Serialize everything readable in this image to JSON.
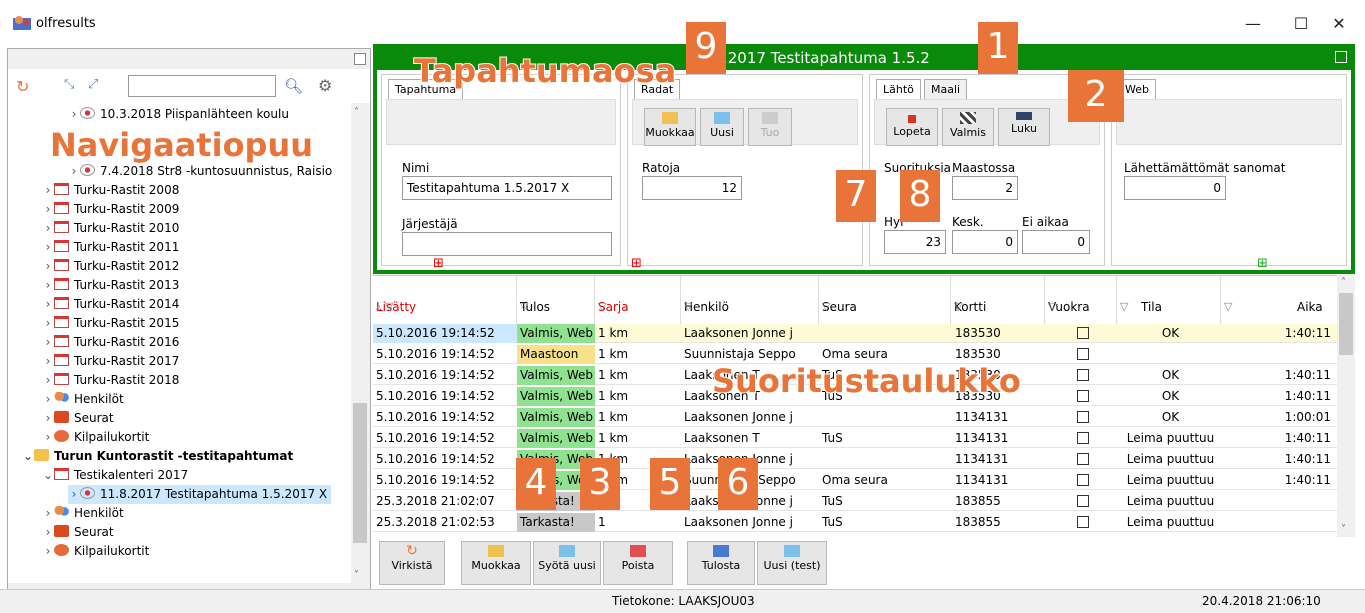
{
  "window": {
    "title": "olfresults",
    "minimize": "—",
    "maximize": "☐",
    "close": "✕"
  },
  "tree": {
    "search_placeholder": "",
    "items": [
      {
        "label": "10.3.2018  Piispanlähteen koulu"
      },
      {
        "label": "7.4.2018  Str8 -kuntosuunnistus, Raisio"
      },
      {
        "label": "Turku-Rastit 2008"
      },
      {
        "label": "Turku-Rastit 2009"
      },
      {
        "label": "Turku-Rastit 2010"
      },
      {
        "label": "Turku-Rastit 2011"
      },
      {
        "label": "Turku-Rastit 2012"
      },
      {
        "label": "Turku-Rastit 2013"
      },
      {
        "label": "Turku-Rastit 2014"
      },
      {
        "label": "Turku-Rastit 2015"
      },
      {
        "label": "Turku-Rastit 2016"
      },
      {
        "label": "Turku-Rastit 2017"
      },
      {
        "label": "Turku-Rastit 2018"
      },
      {
        "label": "Henkilöt"
      },
      {
        "label": "Seurat"
      },
      {
        "label": "Kilpailukortit"
      },
      {
        "label": "Turun Kuntorastit -testitapahtumat"
      },
      {
        "label": "Testikalenteri 2017"
      },
      {
        "label": "11.8.2017  Testitapahtuma 1.5.2017 X"
      },
      {
        "label": "Henkilöt"
      },
      {
        "label": "Seurat"
      },
      {
        "label": "Kilpailukortit"
      }
    ]
  },
  "event_pane": {
    "title": ".2017 Testitapahtuma 1.5.2",
    "tapahtuma_tab": "Tapahtuma",
    "nimi_label": "Nimi",
    "nimi_value": "Testitapahtuma 1.5.2017 X",
    "jarjestaja_label": "Järjestäjä",
    "jarjestaja_value": "",
    "radat_tab": "Radat",
    "muokkaa": "Muokkaa",
    "uusi": "Uusi",
    "tuo": "Tuo",
    "ratoja_label": "Ratoja",
    "ratoja_value": "12",
    "lahto_tab": "Lähtö",
    "maali_tab": "Maali",
    "lopeta": "Lopeta",
    "valmis": "Valmis",
    "luku": "Luku",
    "suorituksia_label": "Suorituksia",
    "maastossa_label": "Maastossa",
    "maastossa_value": "2",
    "hylatty_label": "Hyl",
    "hylatty_value": "23",
    "kesk_label": "Kesk.",
    "kesk_value": "0",
    "ei_aikaa_label": "Ei aikaa",
    "ei_aikaa_value": "0",
    "web_tab": "Web",
    "lahettamattomat_label": "Lähettämättömät sanomat",
    "lahettamattomat_value": "0"
  },
  "grid": {
    "columns": [
      "Lisätty",
      "Tulos",
      "Sarja",
      "Henkilö",
      "Seura",
      "Kortti",
      "Vuokra",
      "Tila",
      "Aika"
    ],
    "rows": [
      {
        "lisatty": "5.10.2016 19:14:52",
        "tulos": "Valmis, Web",
        "sarja": "1 km",
        "henkilo": "Laaksonen Jonne j",
        "seura": "",
        "kortti": "183530",
        "tila": "OK",
        "aika": "1:40:11"
      },
      {
        "lisatty": "5.10.2016 19:14:52",
        "tulos": "Maastoon",
        "sarja": "1 km",
        "henkilo": "Suunnistaja Seppo",
        "seura": "Oma seura",
        "kortti": "183530",
        "tila": "",
        "aika": ""
      },
      {
        "lisatty": "5.10.2016 19:14:52",
        "tulos": "Valmis, Web",
        "sarja": "1 km",
        "henkilo": "Laaksonen T",
        "seura": "TuS",
        "kortti": "183530",
        "tila": "OK",
        "aika": "1:40:11"
      },
      {
        "lisatty": "5.10.2016 19:14:52",
        "tulos": "Valmis, Web",
        "sarja": "1 km",
        "henkilo": "Laaksonen T",
        "seura": "TuS",
        "kortti": "183530",
        "tila": "OK",
        "aika": "1:40:11"
      },
      {
        "lisatty": "5.10.2016 19:14:52",
        "tulos": "Valmis, Web",
        "sarja": "1 km",
        "henkilo": "Laaksonen Jonne j",
        "seura": "",
        "kortti": "1134131",
        "tila": "OK",
        "aika": "1:00:01"
      },
      {
        "lisatty": "5.10.2016 19:14:52",
        "tulos": "Valmis, Web",
        "sarja": "1 km",
        "henkilo": "Laaksonen T",
        "seura": "TuS",
        "kortti": "1134131",
        "tila": "Leima puuttuu",
        "aika": "1:40:11"
      },
      {
        "lisatty": "5.10.2016 19:14:52",
        "tulos": "Valmis, Web",
        "sarja": "1 km",
        "henkilo": "Laaksonen Jonne j",
        "seura": "",
        "kortti": "1134131",
        "tila": "Leima puuttuu",
        "aika": "1:40:11"
      },
      {
        "lisatty": "5.10.2016 19:14:52",
        "tulos": "Valmis, Web",
        "sarja": "1 km",
        "henkilo": "Suunnistaja Seppo",
        "seura": "Oma seura",
        "kortti": "1134131",
        "tila": "Leima puuttuu",
        "aika": "1:40:11"
      },
      {
        "lisatty": "25.3.2018 21:02:07",
        "tulos": "Tarkasta!",
        "sarja": "1",
        "henkilo": "Laaksonen Jonne j",
        "seura": "TuS",
        "kortti": "183855",
        "tila": "Leima puuttuu",
        "aika": ""
      },
      {
        "lisatty": "25.3.2018 21:02:53",
        "tulos": "Tarkasta!",
        "sarja": "1",
        "henkilo": "Laaksonen Jonne j",
        "seura": "TuS",
        "kortti": "183855",
        "tila": "Leima puuttuu",
        "aika": ""
      }
    ]
  },
  "bottom_buttons": {
    "virkista": "Virkistä",
    "muokkaa": "Muokkaa",
    "syota_uusi": "Syötä uusi",
    "poista": "Poista",
    "tulosta": "Tulosta",
    "uusi_test": "Uusi (test)"
  },
  "status": {
    "computer": "Tietokone: LAAKSJOU03",
    "datetime": "20.4.2018 21:06:10"
  },
  "annotations": {
    "tapahtumaosa": "Tapahtumaosa",
    "navigaatiopuu": "Navigaatiopuu",
    "suoritustaulukko": "Suoritustaulukko",
    "n1": "1",
    "n2": "2",
    "n3": "3",
    "n4": "4",
    "n5": "5",
    "n6": "6",
    "n7": "7",
    "n8": "8",
    "n9": "9"
  },
  "colors": {
    "green": "#0a8a0a",
    "valmis": "#8fe28f",
    "maastoon": "#f7e18a",
    "tarkasta": "#c8c8c8",
    "callout": "#e8743a",
    "selected_row": "#fdfbd6",
    "sel_tree": "#cce8ff"
  }
}
